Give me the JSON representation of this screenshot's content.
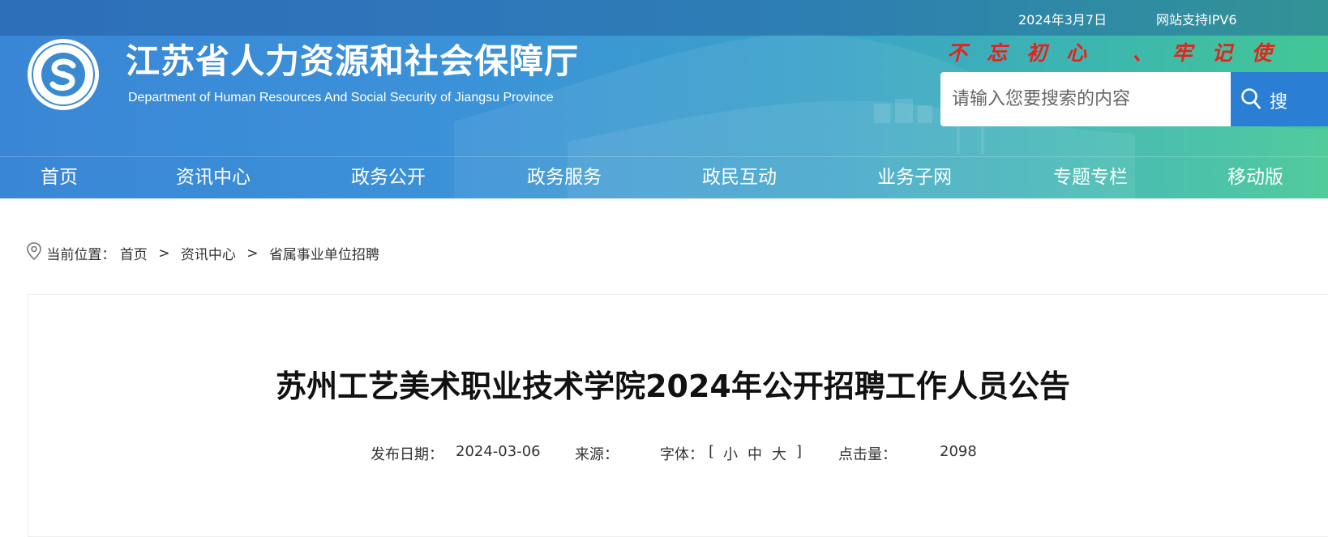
{
  "topbar": {
    "date": "2024年3月7日",
    "ipv6": "网站支持IPV6"
  },
  "header": {
    "logo_icon": "ministry-seal-icon",
    "title": "江苏省人力资源和社会保障厅",
    "subtitle": "Department of Human Resources And Social Security of Jiangsu Province",
    "slogan": "不忘初心 、牢记使"
  },
  "search": {
    "placeholder": "请输入您要搜索的内容",
    "button_label": "搜",
    "icon": "search-icon"
  },
  "nav": {
    "items": [
      {
        "label": "首页"
      },
      {
        "label": "资讯中心"
      },
      {
        "label": "政务公开"
      },
      {
        "label": "政务服务"
      },
      {
        "label": "政民互动"
      },
      {
        "label": "业务子网"
      },
      {
        "label": "专题专栏"
      },
      {
        "label": "移动版"
      }
    ]
  },
  "breadcrumb": {
    "icon": "location-pin-icon",
    "prefix": "当前位置：",
    "separator": ">",
    "items": [
      "首页",
      "资讯中心",
      "省属事业单位招聘"
    ]
  },
  "article": {
    "title": "苏州工艺美术职业技术学院2024年公开招聘工作人员公告",
    "meta": {
      "date_label": "发布日期：",
      "date": "2024-03-06",
      "source_label": "来源：",
      "font_label": "字体：",
      "font_open": "[",
      "font_small": "小",
      "font_medium": "中",
      "font_large": "大",
      "font_close": "]",
      "views_label": "点击量：",
      "views": "2098"
    }
  },
  "colors": {
    "header_start": "#3a86d6",
    "header_end": "#43c795",
    "slogan": "#e4231d",
    "search_button": "#2a7fd4"
  }
}
